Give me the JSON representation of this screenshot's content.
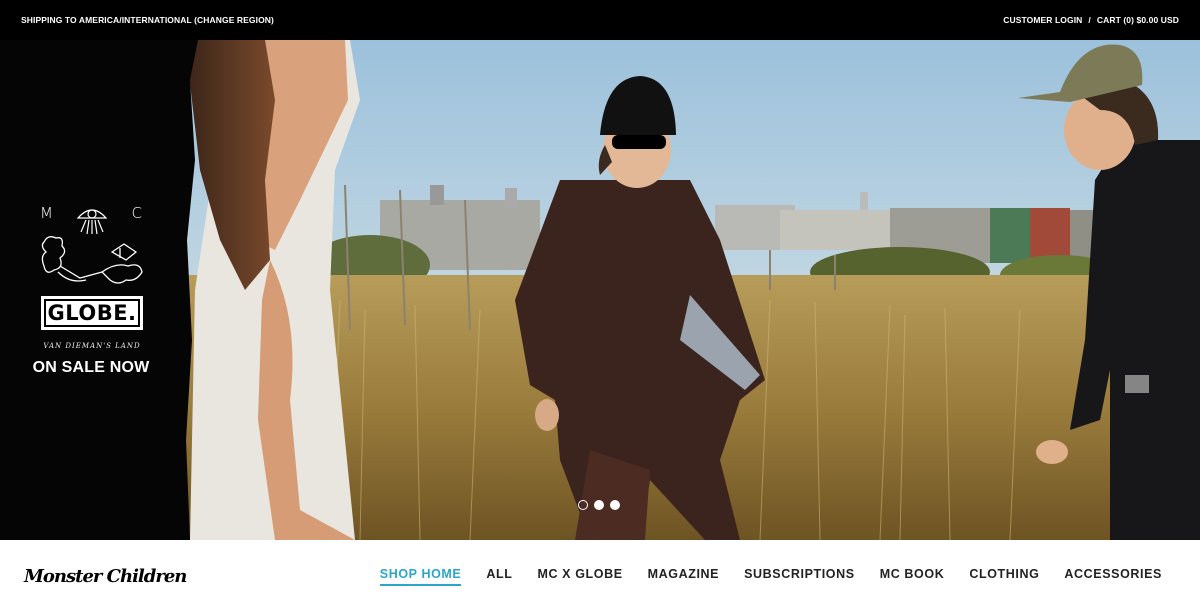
{
  "topbar": {
    "shipping_label": "SHIPPING TO AMERICA/INTERNATIONAL (CHANGE REGION)",
    "login_label": "CUSTOMER LOGIN",
    "separator": "/",
    "cart_label": "CART (0) $0.00 USD"
  },
  "hero": {
    "promo": {
      "mc_left": "M",
      "mc_right": "C",
      "brand_logo": "GLOBE.",
      "subline": "VAN DIEMAN'S LAND",
      "cta": "ON SALE NOW"
    },
    "slides_total": 3,
    "active_slide": 2
  },
  "nav": {
    "brand": "Monster Children",
    "items": [
      {
        "label": "SHOP HOME",
        "active": true
      },
      {
        "label": "ALL",
        "active": false
      },
      {
        "label": "MC X GLOBE",
        "active": false
      },
      {
        "label": "MAGAZINE",
        "active": false
      },
      {
        "label": "SUBSCRIPTIONS",
        "active": false
      },
      {
        "label": "MC BOOK",
        "active": false
      },
      {
        "label": "CLOTHING",
        "active": false
      },
      {
        "label": "ACCESSORIES",
        "active": false
      }
    ]
  },
  "colors": {
    "accent": "#2aa6c9",
    "topbar_bg": "#000000"
  }
}
